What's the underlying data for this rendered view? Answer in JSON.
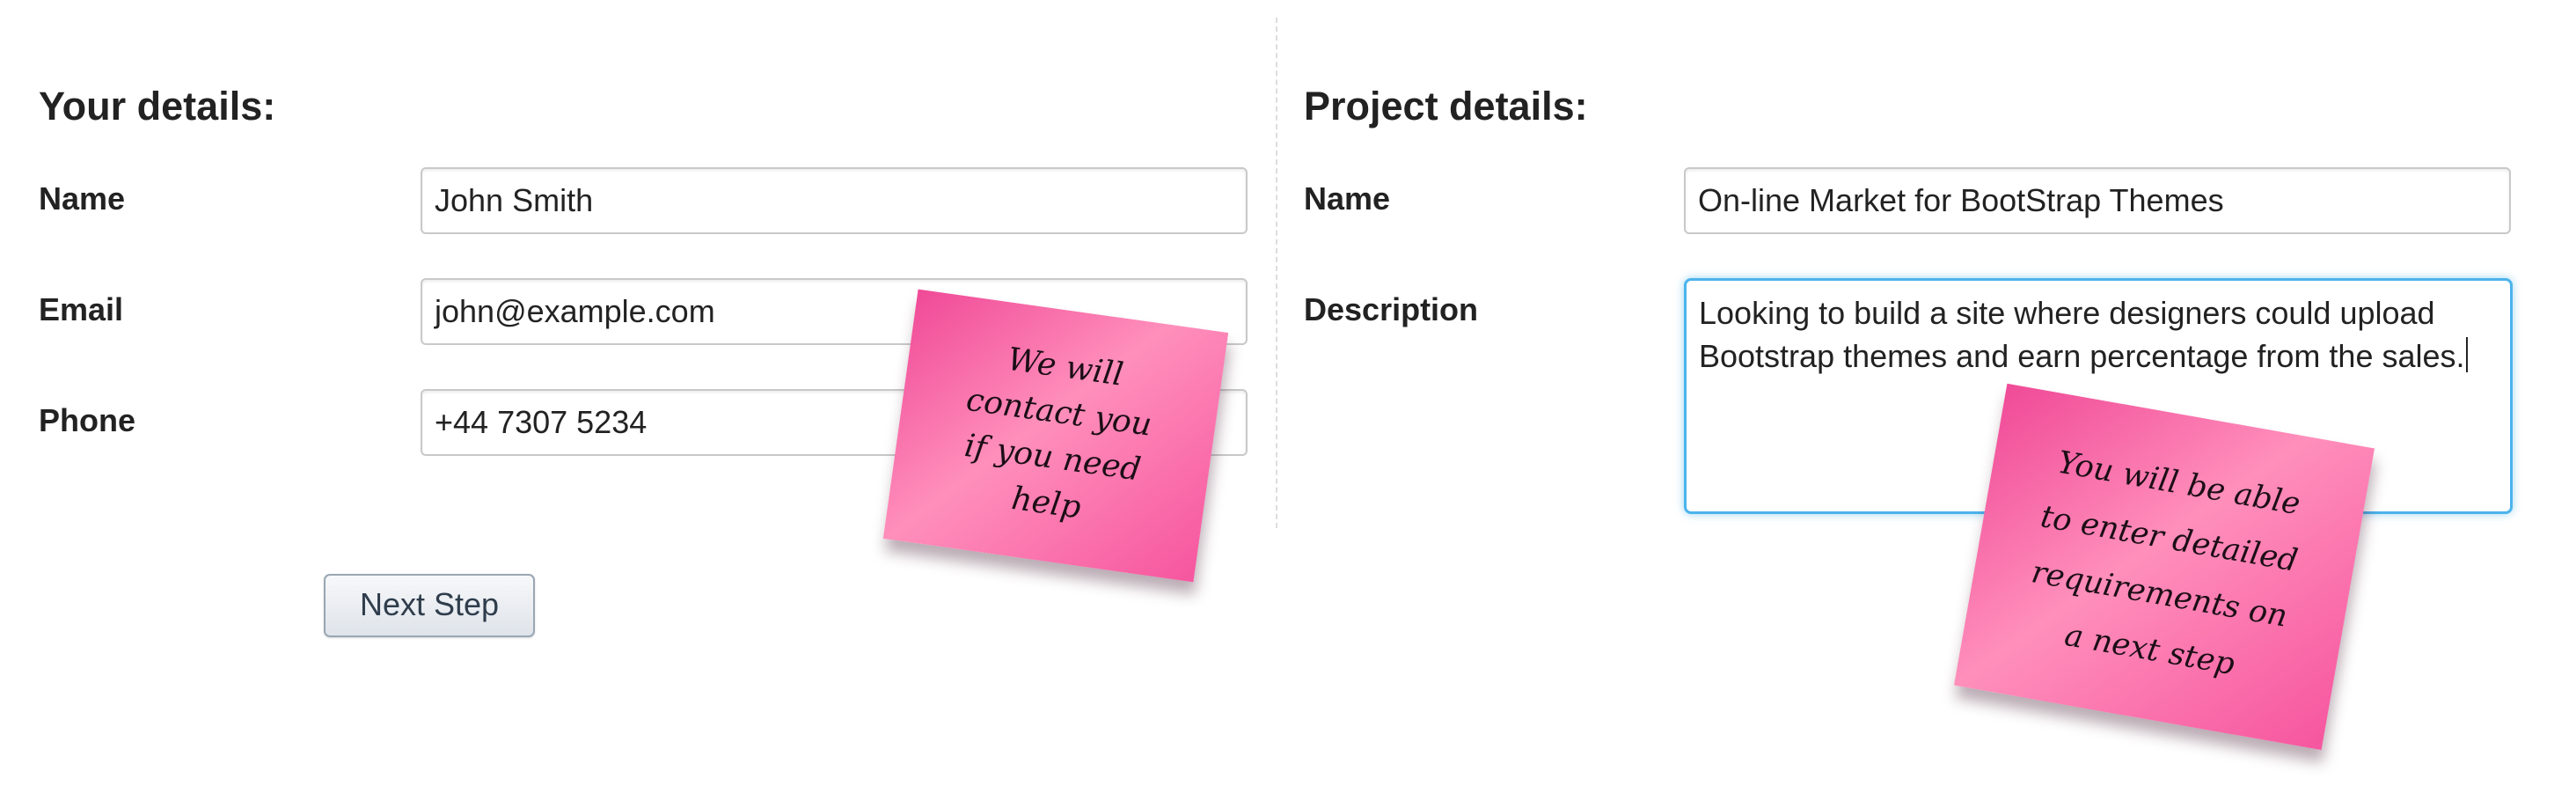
{
  "your_details": {
    "title": "Your details:",
    "name_label": "Name",
    "name_value": "John Smith",
    "email_label": "Email",
    "email_value": "john@example.com",
    "phone_label": "Phone",
    "phone_value": "+44 7307 5234"
  },
  "project_details": {
    "title": "Project details:",
    "name_label": "Name",
    "name_value": "On-line Market for BootStrap Themes",
    "description_label": "Description",
    "description_line1": "Looking to build a site where designers could upload",
    "description_line2": "Bootstrap themes and earn percentage from the sales."
  },
  "actions": {
    "next_step_label": "Next Step"
  },
  "notes": {
    "contact_note": [
      "We will",
      "contact you",
      "if you need",
      "help"
    ],
    "requirements_note": [
      "You will be able",
      "to enter detailed",
      "requirements on",
      "a next step"
    ]
  },
  "colors": {
    "sticky_note": "#f5609f",
    "focus_border": "#4cb3ec"
  }
}
